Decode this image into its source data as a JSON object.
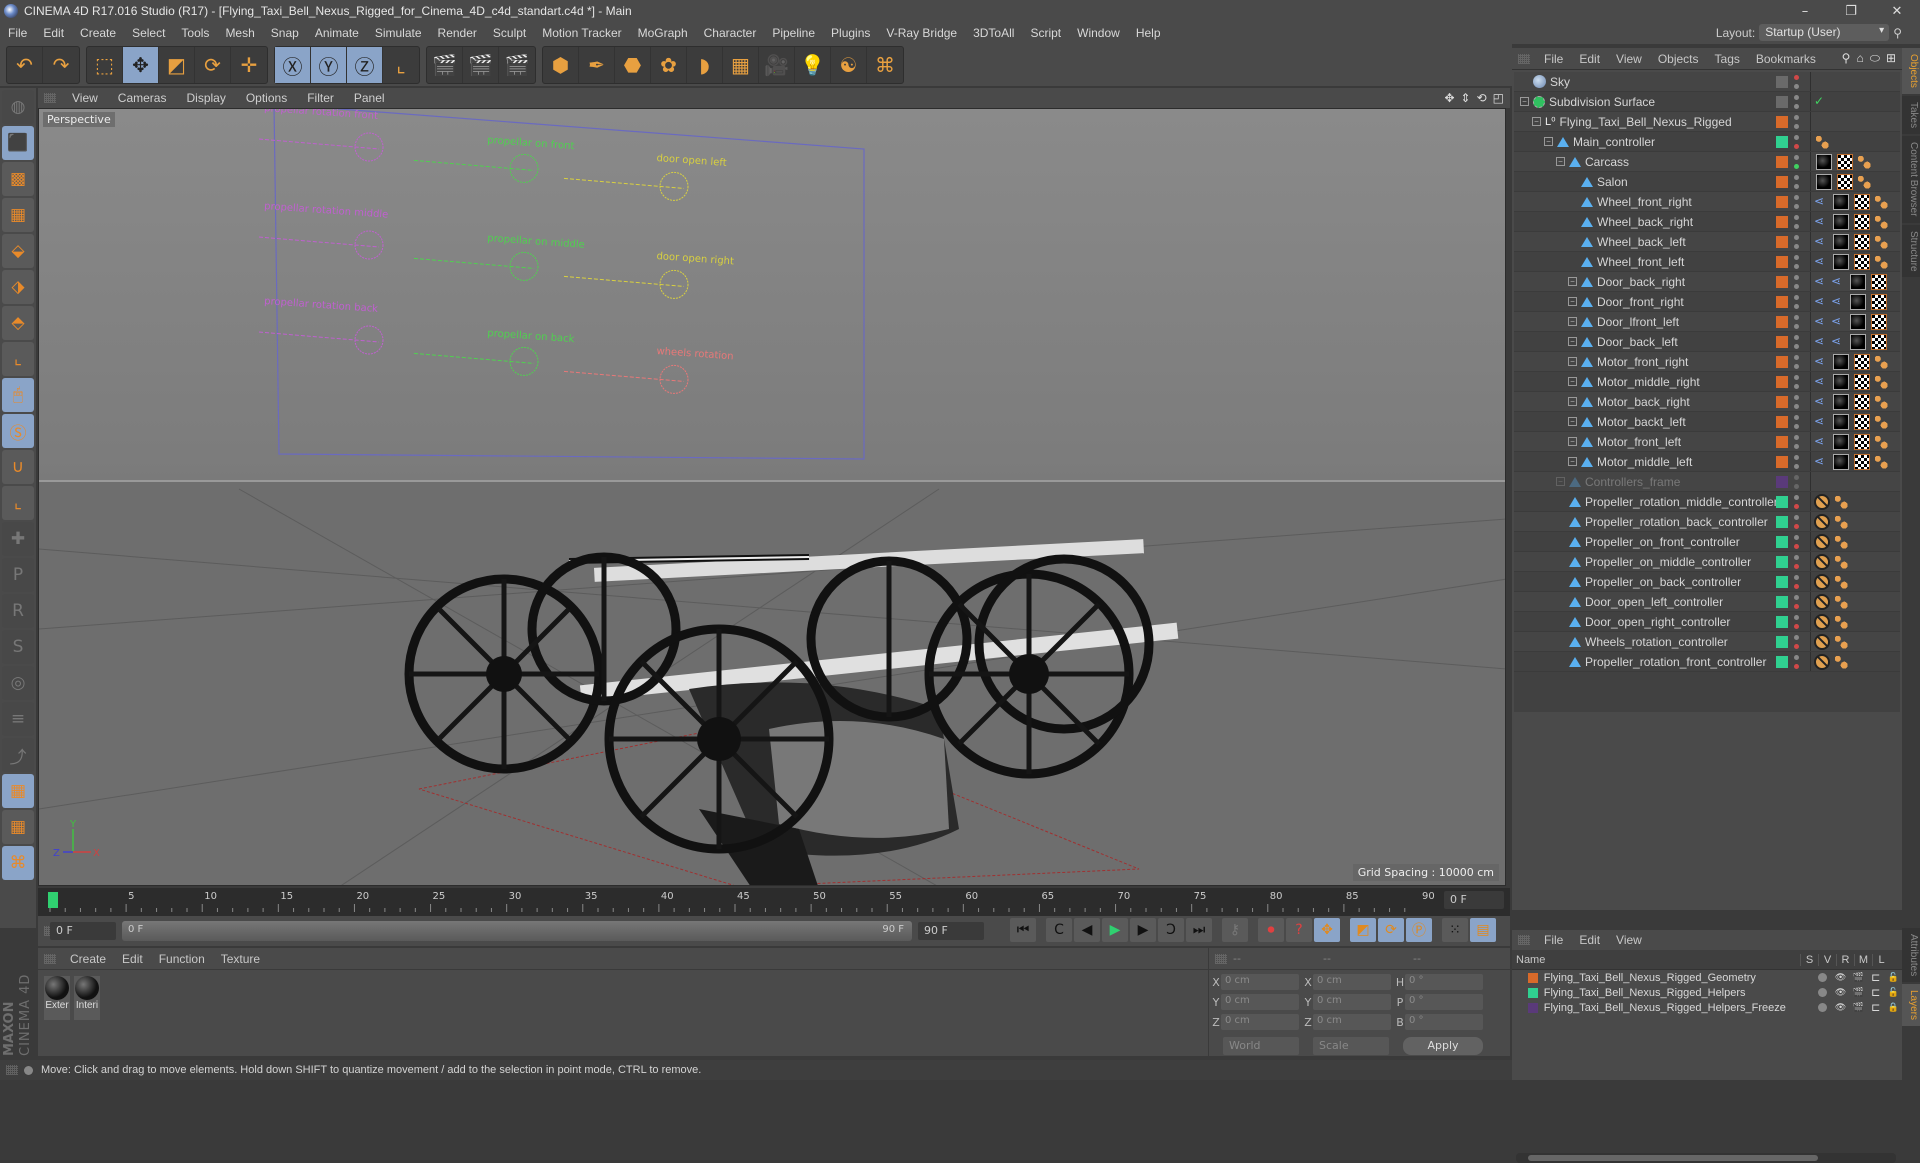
{
  "window": {
    "title": "CINEMA 4D R17.016 Studio (R17) - [Flying_Taxi_Bell_Nexus_Rigged_for_Cinema_4D_c4d_standart.c4d *] - Main",
    "controls": {
      "minimize": "–",
      "restore": "❐",
      "close": "✕"
    }
  },
  "menubar": {
    "items": [
      "File",
      "Edit",
      "Create",
      "Select",
      "Tools",
      "Mesh",
      "Snap",
      "Animate",
      "Simulate",
      "Render",
      "Sculpt",
      "Motion Tracker",
      "MoGraph",
      "Character",
      "Pipeline",
      "Plugins",
      "V-Ray Bridge",
      "3DToAll",
      "Script",
      "Window",
      "Help"
    ],
    "layout_label": "Layout:",
    "layout_value": "Startup (User)"
  },
  "toolbar": {
    "groups": [
      [
        {
          "icon": "undo-icon",
          "glyph": "↶"
        },
        {
          "icon": "redo-icon",
          "glyph": "↷"
        }
      ],
      [
        {
          "icon": "live-selection-icon",
          "glyph": "⬚"
        },
        {
          "icon": "move-icon",
          "glyph": "✥",
          "on": true
        },
        {
          "icon": "scale-icon",
          "glyph": "◩"
        },
        {
          "icon": "rotate-icon",
          "glyph": "⟳"
        },
        {
          "icon": "transform-icon",
          "glyph": "✛"
        }
      ],
      [
        {
          "icon": "x-axis-icon",
          "glyph": "Ⓧ",
          "on": true
        },
        {
          "icon": "y-axis-icon",
          "glyph": "Ⓨ",
          "on": true
        },
        {
          "icon": "z-axis-icon",
          "glyph": "Ⓩ",
          "on": true
        },
        {
          "icon": "coordinate-system-icon",
          "glyph": "⌞"
        }
      ],
      [
        {
          "icon": "render-view-icon",
          "glyph": "🎬"
        },
        {
          "icon": "render-picture-viewer-icon",
          "glyph": "🎬"
        },
        {
          "icon": "render-settings-icon",
          "glyph": "🎬"
        }
      ],
      [
        {
          "icon": "cube-icon",
          "glyph": "⬢"
        },
        {
          "icon": "pen-icon",
          "glyph": "✒"
        },
        {
          "icon": "subdivision-icon",
          "glyph": "⬣"
        },
        {
          "icon": "cloner-icon",
          "glyph": "✿"
        },
        {
          "icon": "deformer-icon",
          "glyph": "◗"
        },
        {
          "icon": "floor-icon",
          "glyph": "▦"
        },
        {
          "icon": "camera-icon",
          "glyph": "🎥"
        },
        {
          "icon": "light-icon",
          "glyph": "💡"
        },
        {
          "icon": "script-icon",
          "glyph": "☯"
        },
        {
          "icon": "python-icon",
          "glyph": "⌘"
        }
      ]
    ]
  },
  "left_toolbar": [
    {
      "icon": "make-editable-icon",
      "glyph": "◍",
      "dim": true
    },
    {
      "icon": "model-mode-icon",
      "glyph": "⬛",
      "on": true
    },
    {
      "icon": "texture-mode-icon",
      "glyph": "▩"
    },
    {
      "icon": "workplane-icon",
      "glyph": "▦"
    },
    {
      "icon": "points-mode-icon",
      "glyph": "⬙"
    },
    {
      "icon": "edges-mode-icon",
      "glyph": "⬗"
    },
    {
      "icon": "polygons-mode-icon",
      "glyph": "⬘"
    },
    {
      "icon": "axis-mode-icon",
      "glyph": "⌞"
    },
    {
      "icon": "tweak-mode-icon",
      "glyph": "🖱",
      "on": true
    },
    {
      "icon": "solo-icon",
      "glyph": "Ⓢ",
      "on": true
    },
    {
      "icon": "snap-icon",
      "glyph": "∪"
    },
    {
      "icon": "workplane-axis-icon",
      "glyph": "⌞"
    },
    {
      "icon": "quantize-icon",
      "glyph": "✚",
      "dim": true
    },
    {
      "icon": "lock-p-icon",
      "glyph": "P",
      "dim": true
    },
    {
      "icon": "lock-r-icon",
      "glyph": "R",
      "dim": true
    },
    {
      "icon": "lock-psr-icon",
      "glyph": "S",
      "dim": true
    },
    {
      "icon": "lock-target-icon",
      "glyph": "◎",
      "dim": true
    },
    {
      "icon": "lock-weight-icon",
      "glyph": "≡",
      "dim": true
    },
    {
      "icon": "lock-ik-icon",
      "glyph": "⤴",
      "dim": true
    },
    {
      "icon": "locked-workplane-icon",
      "glyph": "▦",
      "on": true
    },
    {
      "icon": "align-workplane-icon",
      "glyph": "▦"
    },
    {
      "icon": "python-icon",
      "glyph": "⌘",
      "on": true
    }
  ],
  "viewport": {
    "menu": [
      "View",
      "Cameras",
      "Display",
      "Options",
      "Filter",
      "Panel"
    ],
    "label": "Perspective",
    "grid_spacing": "Grid Spacing : 10000 cm",
    "nav_icons": [
      "move-view-icon",
      "dolly-view-icon",
      "rotate-view-icon",
      "maximize-view-icon"
    ],
    "controller_labels": [
      {
        "text": "propellar rotation front",
        "color": "#c060d0"
      },
      {
        "text": "propellar on front",
        "color": "#50d050"
      },
      {
        "text": "door open left",
        "color": "#d8d040"
      },
      {
        "text": "propellar rotation middle",
        "color": "#c060d0"
      },
      {
        "text": "propellar on middle",
        "color": "#50d050"
      },
      {
        "text": "door open right",
        "color": "#d8d040"
      },
      {
        "text": "propellar rotation back",
        "color": "#c060d0"
      },
      {
        "text": "propellar on back",
        "color": "#50d050"
      },
      {
        "text": "wheels rotation",
        "color": "#e87878"
      }
    ],
    "axis": {
      "x": "X",
      "y": "Y",
      "z": "Z"
    }
  },
  "timeline": {
    "ticks": [
      "0",
      "5",
      "10",
      "15",
      "20",
      "25",
      "30",
      "35",
      "40",
      "45",
      "50",
      "55",
      "60",
      "65",
      "70",
      "75",
      "80",
      "85",
      "90"
    ],
    "current_frame": "0 F",
    "start_field": "0 F",
    "range_start": "0 F",
    "range_end": "90 F",
    "end_field": "90 F",
    "playhead_fraction": 0.0
  },
  "transport": {
    "buttons": [
      {
        "icon": "goto-start-icon",
        "glyph": "⏮"
      },
      {
        "icon": "prev-key-icon",
        "glyph": "C"
      },
      {
        "icon": "prev-frame-icon",
        "glyph": "◀"
      },
      {
        "icon": "play-icon",
        "glyph": "▶"
      },
      {
        "icon": "next-frame-icon",
        "glyph": "▶"
      },
      {
        "icon": "next-key-icon",
        "glyph": "Ↄ"
      },
      {
        "icon": "goto-end-icon",
        "glyph": "⏭"
      },
      {
        "icon": "keyframe-selection-icon",
        "glyph": "⚷"
      },
      {
        "icon": "record-icon",
        "glyph": "⏺"
      },
      {
        "icon": "autokey-icon",
        "glyph": "?"
      },
      {
        "icon": "key-position-icon",
        "glyph": "✥"
      },
      {
        "icon": "key-scale-icon",
        "glyph": "◩"
      },
      {
        "icon": "key-rotation-icon",
        "glyph": "⟳"
      },
      {
        "icon": "key-param-icon",
        "glyph": "Ⓟ"
      },
      {
        "icon": "key-pla-icon",
        "glyph": "⁙"
      },
      {
        "icon": "timeline-icon",
        "glyph": "▤"
      }
    ]
  },
  "materials": {
    "menu": [
      "Create",
      "Edit",
      "Function",
      "Texture"
    ],
    "items": [
      {
        "label": "Exter"
      },
      {
        "label": "Interi"
      }
    ]
  },
  "coords": {
    "headers": [
      "--",
      "--",
      "--"
    ],
    "rows": [
      {
        "a": "X",
        "av": "0 cm",
        "b": "X",
        "bv": "0 cm",
        "c": "H",
        "cv": "0 °"
      },
      {
        "a": "Y",
        "av": "0 cm",
        "b": "Y",
        "bv": "0 cm",
        "c": "P",
        "cv": "0 °"
      },
      {
        "a": "Z",
        "av": "0 cm",
        "b": "Z",
        "bv": "0 cm",
        "c": "B",
        "cv": "0 °"
      }
    ],
    "mode": "World",
    "scale": "Scale",
    "apply": "Apply"
  },
  "status": "Move: Click and drag to move elements. Hold down SHIFT to quantize movement / add to the selection in point mode, CTRL to remove.",
  "object_manager": {
    "menu": [
      "File",
      "Edit",
      "View",
      "Objects",
      "Tags",
      "Bookmarks"
    ],
    "objects": [
      {
        "name": "Sky",
        "depth": 0,
        "icon": "sky-icon",
        "layer": "#6a6a6a",
        "tags": [],
        "dots": [
          "#d04848",
          "#888"
        ]
      },
      {
        "name": "Subdivision Surface",
        "depth": 0,
        "expand": true,
        "icon": "subdivision-surface-icon",
        "layer": "#6a6a6a",
        "tags": [
          "check"
        ],
        "dots": [
          "#888",
          "#888"
        ]
      },
      {
        "name": "Flying_Taxi_Bell_Nexus_Rigged",
        "depth": 1,
        "expand": true,
        "icon": "null-icon",
        "layer": "#d86a2a",
        "tags": [],
        "dots": [
          "#888",
          "#888"
        ]
      },
      {
        "name": "Main_controller",
        "depth": 2,
        "expand": true,
        "icon": "joint-icon",
        "layer": "#30d090",
        "tags": [
          "bal"
        ],
        "dots": [
          "#888",
          "#d04848"
        ]
      },
      {
        "name": "Carcass",
        "depth": 3,
        "expand": true,
        "icon": "joint-icon",
        "layer": "#d86a2a",
        "tags": [
          "mat",
          "chk",
          "bal"
        ],
        "dots": [
          "#888",
          "#40d060"
        ]
      },
      {
        "name": "Salon",
        "depth": 4,
        "icon": "joint-icon",
        "layer": "#d86a2a",
        "tags": [
          "mat",
          "chk",
          "bal"
        ],
        "dots": [
          "#888",
          "#888"
        ]
      },
      {
        "name": "Wheel_front_right",
        "depth": 4,
        "icon": "joint-icon",
        "layer": "#d86a2a",
        "tags": [
          "exp",
          "mat",
          "chk",
          "bal"
        ],
        "dots": [
          "#888",
          "#888"
        ]
      },
      {
        "name": "Wheel_back_right",
        "depth": 4,
        "icon": "joint-icon",
        "layer": "#d86a2a",
        "tags": [
          "exp",
          "mat",
          "chk",
          "bal"
        ],
        "dots": [
          "#888",
          "#888"
        ]
      },
      {
        "name": "Wheel_back_left",
        "depth": 4,
        "icon": "joint-icon",
        "layer": "#d86a2a",
        "tags": [
          "exp",
          "mat",
          "chk",
          "bal"
        ],
        "dots": [
          "#888",
          "#888"
        ]
      },
      {
        "name": "Wheel_front_left",
        "depth": 4,
        "icon": "joint-icon",
        "layer": "#d86a2a",
        "tags": [
          "exp",
          "mat",
          "chk",
          "bal"
        ],
        "dots": [
          "#888",
          "#888"
        ]
      },
      {
        "name": "Door_back_right",
        "depth": 4,
        "expand": true,
        "icon": "joint-icon",
        "layer": "#d86a2a",
        "tags": [
          "exp",
          "exp",
          "mat",
          "chk"
        ],
        "dots": [
          "#888",
          "#888"
        ]
      },
      {
        "name": "Door_front_right",
        "depth": 4,
        "expand": true,
        "icon": "joint-icon",
        "layer": "#d86a2a",
        "tags": [
          "exp",
          "exp",
          "mat",
          "chk"
        ],
        "dots": [
          "#888",
          "#888"
        ]
      },
      {
        "name": "Door_lfront_left",
        "depth": 4,
        "expand": true,
        "icon": "joint-icon",
        "layer": "#d86a2a",
        "tags": [
          "exp",
          "exp",
          "mat",
          "chk"
        ],
        "dots": [
          "#888",
          "#888"
        ]
      },
      {
        "name": "Door_back_left",
        "depth": 4,
        "expand": true,
        "icon": "joint-icon",
        "layer": "#d86a2a",
        "tags": [
          "exp",
          "exp",
          "mat",
          "chk"
        ],
        "dots": [
          "#888",
          "#888"
        ]
      },
      {
        "name": "Motor_front_right",
        "depth": 4,
        "expand": true,
        "icon": "joint-icon",
        "layer": "#d86a2a",
        "tags": [
          "exp",
          "mat",
          "chk",
          "bal"
        ],
        "dots": [
          "#888",
          "#888"
        ]
      },
      {
        "name": "Motor_middle_right",
        "depth": 4,
        "expand": true,
        "icon": "joint-icon",
        "layer": "#d86a2a",
        "tags": [
          "exp",
          "mat",
          "chk",
          "bal"
        ],
        "dots": [
          "#888",
          "#888"
        ]
      },
      {
        "name": "Motor_back_right",
        "depth": 4,
        "expand": true,
        "icon": "joint-icon",
        "layer": "#d86a2a",
        "tags": [
          "exp",
          "mat",
          "chk",
          "bal"
        ],
        "dots": [
          "#888",
          "#888"
        ]
      },
      {
        "name": "Motor_backt_left",
        "depth": 4,
        "expand": true,
        "icon": "joint-icon",
        "layer": "#d86a2a",
        "tags": [
          "exp",
          "mat",
          "chk",
          "bal"
        ],
        "dots": [
          "#888",
          "#888"
        ]
      },
      {
        "name": "Motor_front_left",
        "depth": 4,
        "expand": true,
        "icon": "joint-icon",
        "layer": "#d86a2a",
        "tags": [
          "exp",
          "mat",
          "chk",
          "bal"
        ],
        "dots": [
          "#888",
          "#888"
        ]
      },
      {
        "name": "Motor_middle_left",
        "depth": 4,
        "expand": true,
        "icon": "joint-icon",
        "layer": "#d86a2a",
        "tags": [
          "exp",
          "mat",
          "chk",
          "bal"
        ],
        "dots": [
          "#888",
          "#888"
        ]
      },
      {
        "name": "Controllers_frame",
        "depth": 3,
        "expand": true,
        "icon": "joint-icon",
        "layer": "#5a3a7a",
        "dim": true,
        "tags": [],
        "dots": [
          "#666",
          "#666"
        ]
      },
      {
        "name": "Propeller_rotation_middle_controller",
        "depth": 3,
        "icon": "joint-icon",
        "layer": "#30d090",
        "tags": [
          "pro",
          "bal"
        ],
        "dots": [
          "#888",
          "#d04848"
        ]
      },
      {
        "name": "Propeller_rotation_back_controller",
        "depth": 3,
        "icon": "joint-icon",
        "layer": "#30d090",
        "tags": [
          "pro",
          "bal"
        ],
        "dots": [
          "#888",
          "#d04848"
        ]
      },
      {
        "name": "Propeller_on_front_controller",
        "depth": 3,
        "icon": "joint-icon",
        "layer": "#30d090",
        "tags": [
          "pro",
          "bal"
        ],
        "dots": [
          "#888",
          "#d04848"
        ]
      },
      {
        "name": "Propeller_on_middle_controller",
        "depth": 3,
        "icon": "joint-icon",
        "layer": "#30d090",
        "tags": [
          "pro",
          "bal"
        ],
        "dots": [
          "#888",
          "#d04848"
        ]
      },
      {
        "name": "Propeller_on_back_controller",
        "depth": 3,
        "icon": "joint-icon",
        "layer": "#30d090",
        "tags": [
          "pro",
          "bal"
        ],
        "dots": [
          "#888",
          "#d04848"
        ]
      },
      {
        "name": "Door_open_left_controller",
        "depth": 3,
        "icon": "joint-icon",
        "layer": "#30d090",
        "tags": [
          "pro",
          "bal"
        ],
        "dots": [
          "#888",
          "#d04848"
        ]
      },
      {
        "name": "Door_open_right_controller",
        "depth": 3,
        "icon": "joint-icon",
        "layer": "#30d090",
        "tags": [
          "pro",
          "bal"
        ],
        "dots": [
          "#888",
          "#d04848"
        ]
      },
      {
        "name": "Wheels_rotation_controller",
        "depth": 3,
        "icon": "joint-icon",
        "layer": "#30d090",
        "tags": [
          "pro",
          "bal"
        ],
        "dots": [
          "#888",
          "#d04848"
        ]
      },
      {
        "name": "Propeller_rotation_front_controller",
        "depth": 3,
        "icon": "joint-icon",
        "layer": "#30d090",
        "tags": [
          "pro",
          "bal"
        ],
        "dots": [
          "#888",
          "#d04848"
        ]
      }
    ]
  },
  "side_tabs": [
    {
      "label": "Objects",
      "active": true
    },
    {
      "label": "Takes"
    },
    {
      "label": "Content Browser"
    },
    {
      "label": "Structure"
    }
  ],
  "side_tabs_bottom": [
    {
      "label": "Attributes"
    },
    {
      "label": "Layers",
      "active": true
    }
  ],
  "layer_manager": {
    "menu": [
      "File",
      "Edit",
      "View"
    ],
    "columns": [
      "Name",
      "S",
      "V",
      "R",
      "M",
      "L"
    ],
    "layers": [
      {
        "name": "Flying_Taxi_Bell_Nexus_Rigged_Geometry",
        "color": "#d86a2a",
        "locked": false
      },
      {
        "name": "Flying_Taxi_Bell_Nexus_Rigged_Helpers",
        "color": "#30d090",
        "locked": false
      },
      {
        "name": "Flying_Taxi_Bell_Nexus_Rigged_Helpers_Freeze",
        "color": "#5a3a7a",
        "locked": true
      }
    ]
  },
  "brand": {
    "line1": "MAXON",
    "line2": "CINEMA 4D"
  }
}
